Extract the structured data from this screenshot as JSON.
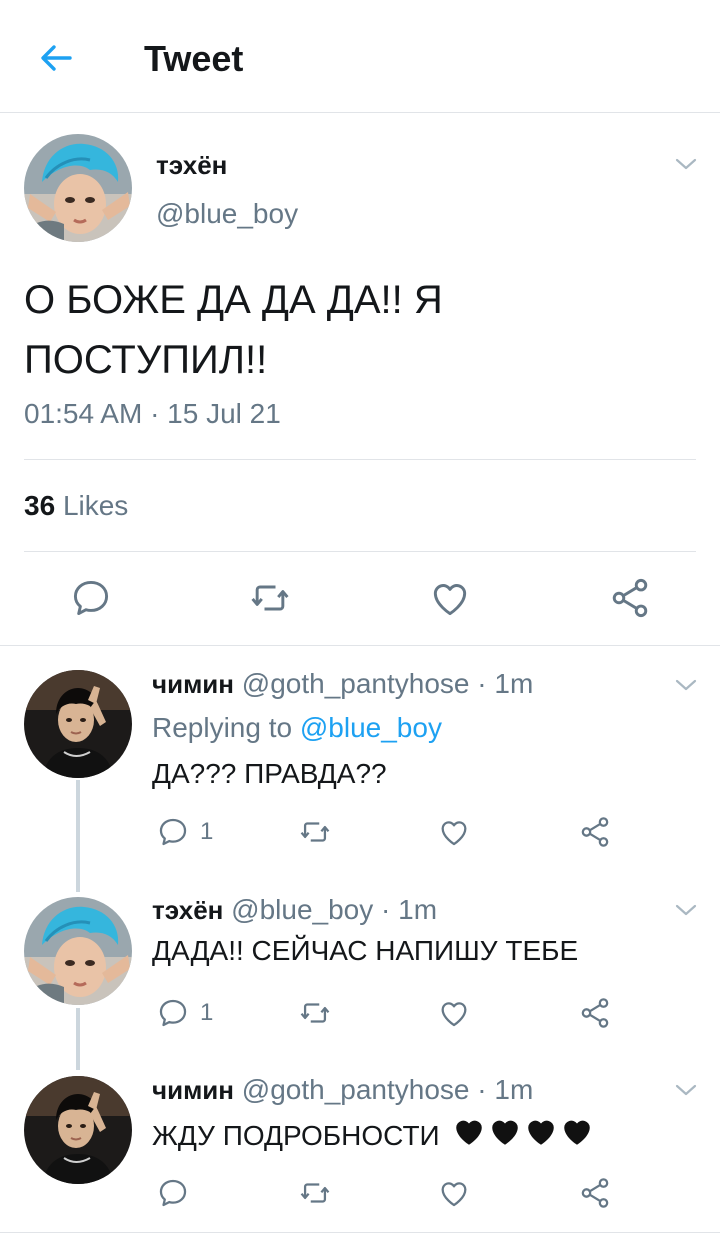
{
  "header": {
    "title": "Tweet"
  },
  "main_tweet": {
    "display_name": "тэхён",
    "handle": "@blue_boy",
    "text": "О БОЖЕ ДА ДА ДА!! Я ПОСТУПИЛ!!",
    "timestamp": "01:54 AM · 15 Jul 21",
    "likes_count": "36",
    "likes_label": "Likes"
  },
  "replies": [
    {
      "display_name": "чимин",
      "meta": "@goth_pantyhose · 1m",
      "replying_to_label": "Replying to",
      "replying_to_handle": "@blue_boy",
      "text": "ДА??? ПРАВДА??",
      "reply_count": "1"
    },
    {
      "display_name": "тэхён",
      "meta": "@blue_boy · 1m",
      "text": "ДАДА!! СЕЙЧАС НАПИШУ ТЕБЕ",
      "reply_count": "1"
    },
    {
      "display_name": "чимин",
      "meta": "@goth_pantyhose · 1m",
      "text": "ЖДУ ПОДРОБНОСТИ",
      "hearts": "🖤🖤🖤🖤",
      "reply_count": ""
    }
  ],
  "colors": {
    "accent": "#1da1f2",
    "secondary_text": "#657786",
    "divider": "#e1e4e8"
  },
  "icons": [
    "back-arrow-icon",
    "chevron-down-icon",
    "reply-icon",
    "retweet-icon",
    "like-icon",
    "share-icon"
  ]
}
